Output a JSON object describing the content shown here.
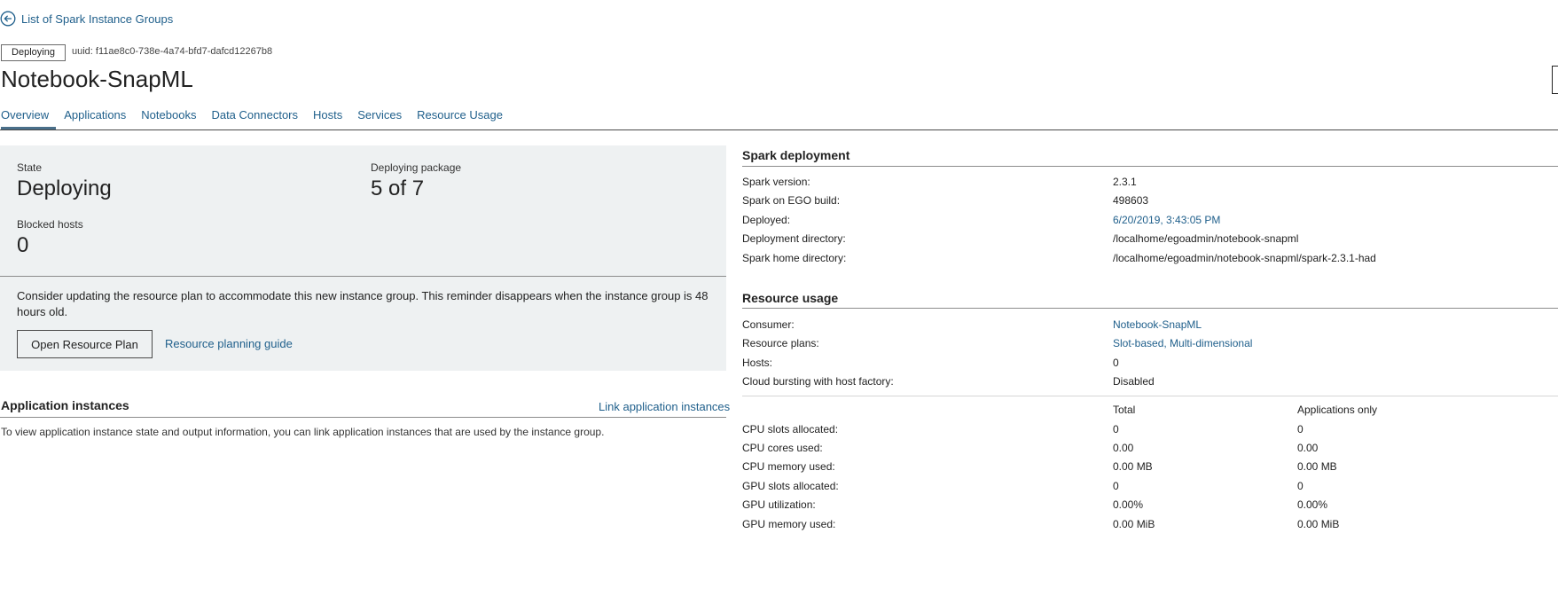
{
  "back_link": {
    "label": "List of Spark Instance Groups",
    "icon": "arrow-left-circle-icon"
  },
  "header": {
    "state_badge": "Deploying",
    "uuid": "uuid: f11ae8c0-738e-4a74-bfd7-dafcd12267b8",
    "title": "Notebook-SnapML"
  },
  "tabs": [
    {
      "label": "Overview",
      "active": true
    },
    {
      "label": "Applications"
    },
    {
      "label": "Notebooks"
    },
    {
      "label": "Data Connectors"
    },
    {
      "label": "Hosts"
    },
    {
      "label": "Services"
    },
    {
      "label": "Resource Usage"
    }
  ],
  "summary": {
    "state_label": "State",
    "state_value": "Deploying",
    "package_label": "Deploying package",
    "package_value": "5 of 7",
    "blocked_label": "Blocked hosts",
    "blocked_value": "0",
    "reminder": "Consider updating the resource plan to accommodate this new instance group. This reminder disappears when the instance group is 48 hours old.",
    "open_plan_button": "Open Resource Plan",
    "guide_link": "Resource planning guide"
  },
  "app_instances": {
    "title": "Application instances",
    "link": "Link application instances",
    "description": "To view application instance state and output information, you can link application instances that are used by the instance group."
  },
  "spark_deployment": {
    "title": "Spark deployment",
    "rows": [
      {
        "label": "Spark version:",
        "value": "2.3.1"
      },
      {
        "label": "Spark on EGO build:",
        "value": "498603"
      },
      {
        "label": "Deployed:",
        "value": "6/20/2019, 3:43:05 PM"
      },
      {
        "label": "Deployment directory:",
        "value": "/localhome/egoadmin/notebook-snapml"
      },
      {
        "label": "Spark home directory:",
        "value": "/localhome/egoadmin/notebook-snapml/spark-2.3.1-had"
      }
    ]
  },
  "resource_usage": {
    "title": "Resource usage",
    "consumer_label": "Consumer:",
    "consumer_value": "Notebook-SnapML",
    "plans_label": "Resource plans:",
    "plans_value": "Slot-based, Multi-dimensional",
    "hosts_label": "Hosts:",
    "hosts_value": "0",
    "bursting_label": "Cloud bursting with host factory:",
    "bursting_value": "Disabled",
    "col_total": "Total",
    "col_apps": "Applications only",
    "metrics": [
      {
        "label": "CPU slots allocated:",
        "total": "0",
        "apps": "0"
      },
      {
        "label": "CPU cores used:",
        "total": "0.00",
        "apps": "0.00"
      },
      {
        "label": "CPU memory used:",
        "total": "0.00 MB",
        "apps": "0.00 MB"
      },
      {
        "label": "GPU slots allocated:",
        "total": "0",
        "apps": "0"
      },
      {
        "label": "GPU utilization:",
        "total": "0.00%",
        "apps": "0.00%"
      },
      {
        "label": "GPU memory used:",
        "total": "0.00 MiB",
        "apps": "0.00 MiB"
      }
    ]
  }
}
